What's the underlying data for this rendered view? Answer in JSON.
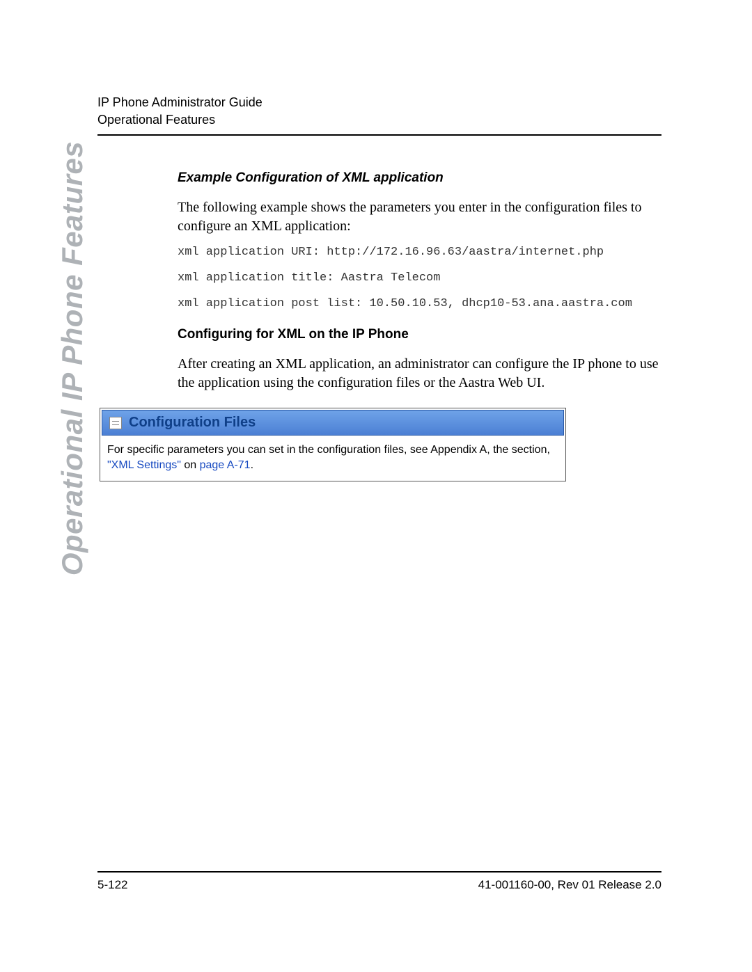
{
  "header": {
    "line1": "IP Phone Administrator Guide",
    "line2": "Operational Features"
  },
  "sidebar_label": "Operational IP Phone Features",
  "section1": {
    "heading": "Example Configuration of XML application",
    "para": "The following example shows the parameters you enter in the configuration files to configure an XML application:",
    "code1": "xml application URI: http://172.16.96.63/aastra/internet.php",
    "code2": "xml application title: Aastra Telecom",
    "code3": "xml application post list: 10.50.10.53, dhcp10-53.ana.aastra.com"
  },
  "section2": {
    "heading": "Configuring for XML on the IP Phone",
    "para": "After creating an XML application, an administrator can configure the IP phone to use the application using the configuration files or the Aastra Web UI."
  },
  "callout": {
    "title": "Configuration Files",
    "body_pre": "For specific parameters you can set in the configuration files, see Appendix A, the section, ",
    "link1": "\"XML Settings\"",
    "mid": " on ",
    "link2": "page A-71",
    "post": "."
  },
  "footer": {
    "page": "5-122",
    "doc": "41-001160-00, Rev 01  Release 2.0"
  }
}
